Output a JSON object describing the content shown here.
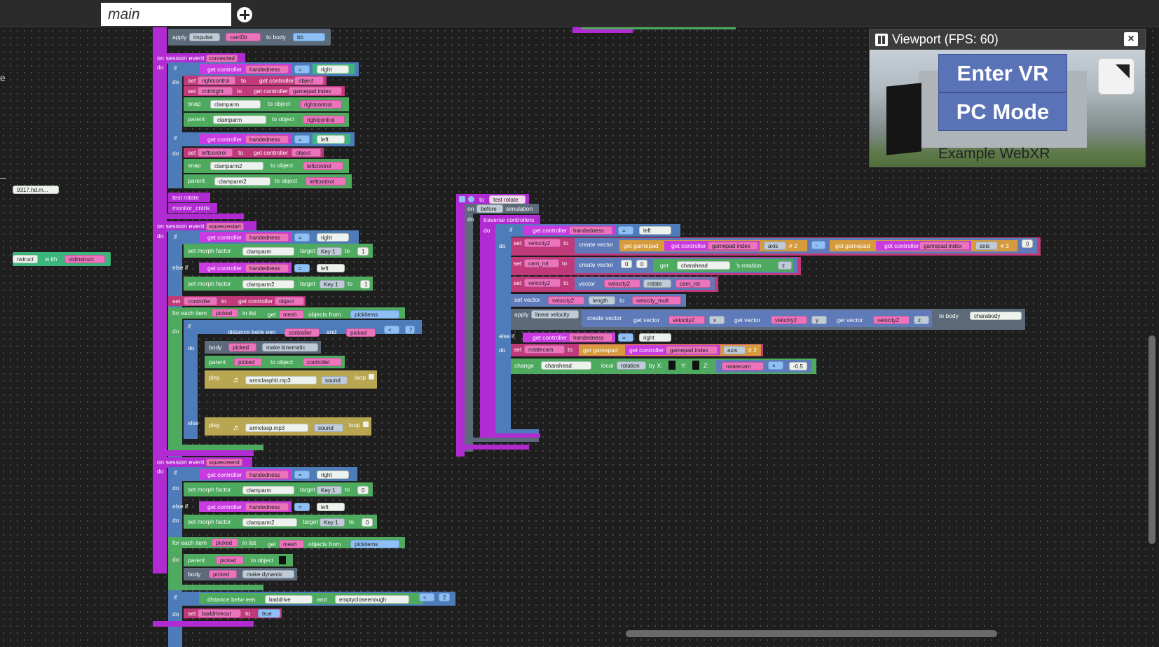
{
  "tabs": {
    "active_label": "main"
  },
  "viewport": {
    "title": "Viewport (FPS: 60)",
    "enter_vr": "Enter VR",
    "pc_mode": "PC Mode",
    "caption": "Example WebXR"
  },
  "blocks": {
    "apply_impulse": {
      "apply": "apply",
      "impulse": "impulse",
      "camdir": "camDir",
      "to_body": "to body",
      "bb": "bb"
    },
    "left_edge": {
      "e": "e",
      "hdm": "9317.hd.m...",
      "nstruct": "nstruct",
      "with": "w ith",
      "vidinstruct": "vidinstruct"
    },
    "connected": {
      "header": "on session event",
      "event": "connected",
      "do": "do",
      "if": "if",
      "get_controller": "get controller",
      "handedness": "handedness",
      "eq": "= ",
      "right": "right",
      "left": "left",
      "set": "set",
      "rightcontrol": "rightcontrol",
      "to": "to",
      "object": "object",
      "cntrlright": "cntrlright",
      "gamepad_index": "gamepad index",
      "snap": "snap",
      "clamparm": "clamparm",
      "to_object": "to object",
      "parent": "parent",
      "leftcontrol": "leftcontrol",
      "clamparm2": "clamparm2",
      "test_rotate": "test rotate",
      "monitor": "monitor_cntrls"
    },
    "squeezestart": {
      "header": "on session event",
      "event": "squeezestart",
      "set_morph": "set morph factor",
      "target": "target",
      "key1": "Key 1",
      "one": "1",
      "else_if": "else if",
      "set_controller": "set",
      "controller": "controller",
      "for_each": "for each item",
      "picked": "picked",
      "in_list": "in list",
      "get": "get",
      "mesh": "mesh",
      "objects_from": "objects from",
      "pickitems": "pickitems",
      "distance": "distance betw een",
      "and": "and",
      "lt": "< ",
      "seven": "7",
      "body": "body",
      "make_kinematic": "make kinematic",
      "play": "play",
      "armclasphit": "armclasphit.mp3",
      "sound": "sound",
      "loop": "loop",
      "else": "else",
      "armclasp": "armclasp.mp3"
    },
    "squeezeend": {
      "header": "on session event",
      "event": "squeezeend",
      "zero": "0",
      "make_dynamic": "make dynamic",
      "baddrive": "baddrive",
      "emptycloseenough": "emptycloseenough",
      "two": "2",
      "baddriveout": "baddriveout",
      "true": "true"
    },
    "test_rotate": {
      "to": "to",
      "name": "test rotate",
      "on": "on",
      "before": "before",
      "simulation": "simulation",
      "traverse": "traverse controllers",
      "velocity2": "velocity2",
      "create_vector": "create vector",
      "get_gamepad": "get gamepad",
      "axis": "axis",
      "hash2": "# 2",
      "hash3": "# 3",
      "minus": "- ",
      "zero": "0",
      "cam_rot": "cam_rot",
      "charahead": "charahead",
      "s_rotation": "'s rotation",
      "z": "z",
      "vector": "vector",
      "rotate": "rotate",
      "set_vector": "set vector",
      "length": "length",
      "velocity_mult": "velocity_mult",
      "apply": "apply",
      "linear_velocity": "linear velocity",
      "get_vector": "get vector",
      "x": "x",
      "y": "y",
      "to_body": "to body",
      "charabody": "charabody",
      "rotatecam": "rotatecam",
      "change": "change",
      "local": "local",
      "rotation": "rotation",
      "by_x": "by X:",
      "y_lbl": "Y:",
      "z_lbl": "Z:",
      "times": "× ",
      "neg": "-0.5"
    }
  }
}
